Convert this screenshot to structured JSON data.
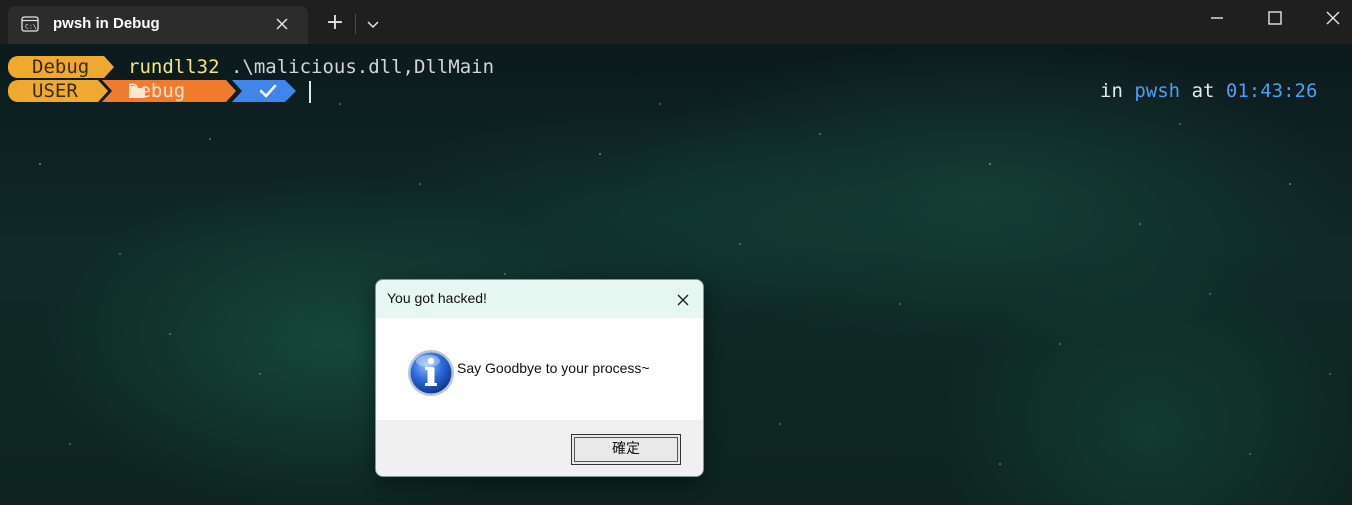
{
  "window": {
    "tab_title": "pwsh in Debug",
    "tab_icon": "terminal-icon",
    "new_tab_label": "+",
    "close_tab_icon": "close-icon"
  },
  "prompt": {
    "line1_segment": "Debug",
    "user_segment": "USER",
    "folder_segment": "Debug",
    "status_icon": "check-icon",
    "command_exe": "rundll32",
    "command_args": " .\\malicious.dll,DllMain",
    "right_in": "in",
    "right_shell": "pwsh",
    "right_at": "at",
    "right_time": "01:43:26"
  },
  "dialog": {
    "title": "You got hacked!",
    "message": "Say Goodbye to your process~",
    "ok_label": "確定",
    "icon": "info-icon"
  },
  "colors": {
    "segment_yellow": "#f0a92f",
    "segment_orange": "#f07b2c",
    "segment_blue": "#3f86ea",
    "command_yellow": "#f5e57a",
    "accent_blue": "#4c9ef5"
  }
}
